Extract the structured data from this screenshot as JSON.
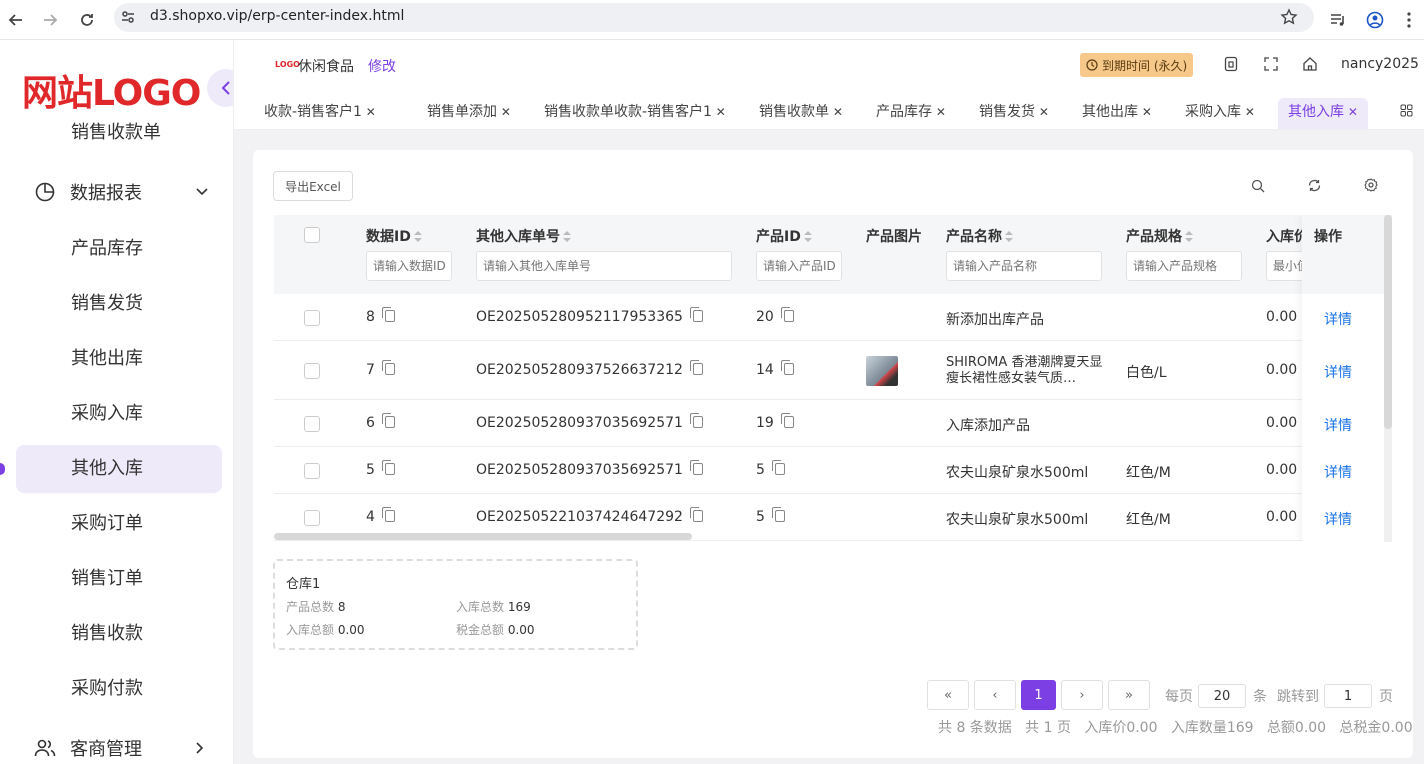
{
  "browser": {
    "url": "d3.shopxo.vip/erp-center-index.html"
  },
  "sidebar": {
    "logo": "网站LOGO",
    "partial_item": "销售收款单",
    "group_reports": "数据报表",
    "items": [
      "产品库存",
      "销售发货",
      "其他出库",
      "采购入库",
      "其他入库",
      "采购订单",
      "销售订单",
      "销售收款",
      "采购付款"
    ],
    "active_index": 4,
    "group_customers": "客商管理"
  },
  "topbar": {
    "logo_small": "LOGO",
    "store": "休闲食品",
    "edit": "修改",
    "expire": "到期时间 (永久)",
    "user": "nancy2025"
  },
  "tabs": [
    "收款-销售客户1",
    "销售单添加",
    "销售收款单收款-销售客户1",
    "销售收款单",
    "产品库存",
    "销售发货",
    "其他出库",
    "采购入库",
    "其他入库"
  ],
  "toolbar": {
    "export": "导出Excel"
  },
  "table": {
    "headers": [
      "数据ID",
      "其他入库单号",
      "产品ID",
      "产品图片",
      "产品名称",
      "产品规格",
      "入库价",
      "操作"
    ],
    "filters": [
      "请输入数据ID",
      "请输入其他入库单号",
      "请输入产品ID",
      "请输入产品名称",
      "请输入产品规格",
      "最小值"
    ],
    "rows": [
      {
        "id": "8",
        "no": "OE202505280952117953365",
        "pid": "20",
        "name": "新添加出库产品",
        "spec": "",
        "price": "0.00",
        "action": "详情"
      },
      {
        "id": "7",
        "no": "OE202505280937526637212",
        "pid": "14",
        "name": "SHIROMA 香港潮牌夏天显瘦长裙性感女装气质…",
        "spec": "白色/L",
        "price": "0.00",
        "action": "详情"
      },
      {
        "id": "6",
        "no": "OE202505280937035692571",
        "pid": "19",
        "name": "入库添加产品",
        "spec": "",
        "price": "0.00",
        "action": "详情"
      },
      {
        "id": "5",
        "no": "OE202505280937035692571",
        "pid": "5",
        "name": "农夫山泉矿泉水500ml",
        "spec": "红色/M",
        "price": "0.00",
        "action": "详情"
      },
      {
        "id": "4",
        "no": "OE202505221037424647292",
        "pid": "5",
        "name": "农夫山泉矿泉水500ml",
        "spec": "红色/M",
        "price": "0.00",
        "action": "详情"
      }
    ]
  },
  "stats": {
    "title": "仓库1",
    "product_total_label": "产品总数",
    "product_total": "8",
    "in_total_label": "入库总数",
    "in_total": "169",
    "amount_label": "入库总额",
    "amount": "0.00",
    "tax_label": "税金总额",
    "tax": "0.00"
  },
  "pagination": {
    "current": "1",
    "per_page_label": "每页",
    "per_page": "20",
    "unit": "条",
    "goto_label": "跳转到",
    "goto": "1",
    "page_unit": "页",
    "summary": "共 8 条数据   共 1 页   入库价0.00   入库数量169   总额0.00   总税金0.00"
  },
  "colors": {
    "accent": "#7b3fe4",
    "link": "#1a73e8",
    "logo": "#e0272a"
  }
}
